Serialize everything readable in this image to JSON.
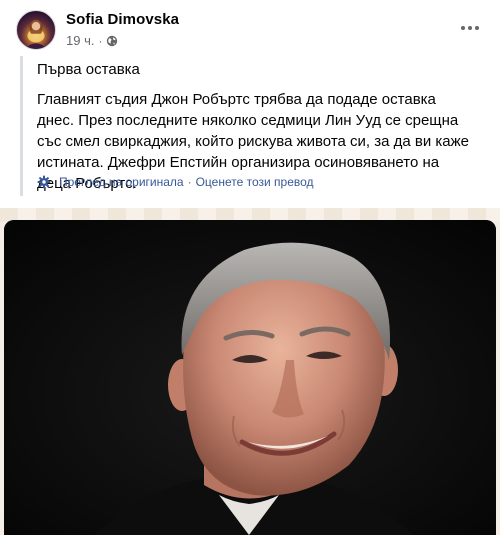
{
  "post": {
    "author": "Sofia Dimovska",
    "time": "19 ч.",
    "separator": "·",
    "privacy_icon": "globe-icon",
    "more_icon": "more-dots-icon"
  },
  "translation": {
    "title": "Първа оставка",
    "body": "Главният съдия Джон Робъртс трябва да подаде оставка днес. През последните няколко седмици Лин Ууд се срещна със смел свирка­джия, който рискува живота си, за да ви каже истината. Джефри Епстийн организира осиновяването на деца Робъртс.",
    "see_original": "Преглед на оригинала",
    "footer_separator": "·",
    "rate_translation": "Оценете този превод",
    "settings_icon": "gear-icon"
  },
  "colors": {
    "link": "#385898",
    "secondary_text": "#65676b",
    "quote_bar": "#dadde1"
  }
}
